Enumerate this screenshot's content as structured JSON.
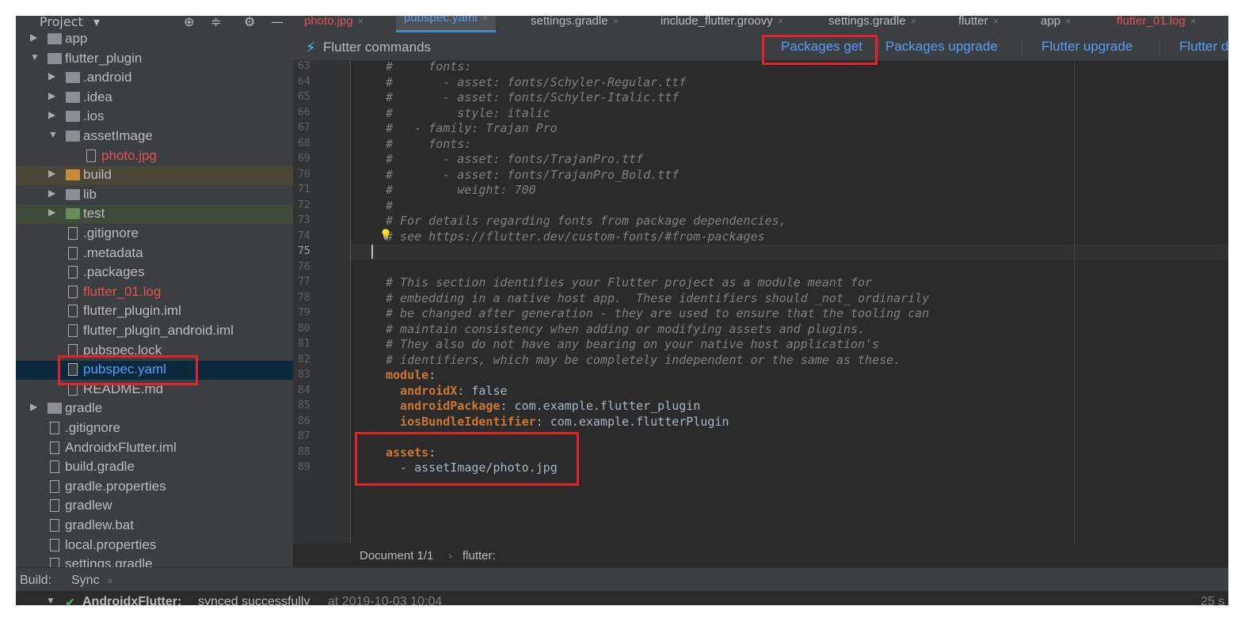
{
  "project_panel": {
    "title": "Project",
    "tree": [
      {
        "label": "app",
        "type": "module",
        "arrow": "▶"
      },
      {
        "label": "flutter_plugin",
        "type": "folder",
        "arrow": "▼"
      },
      {
        "label": ".android",
        "type": "folder",
        "arrow": "▶"
      },
      {
        "label": ".idea",
        "type": "folder",
        "arrow": "▶"
      },
      {
        "label": ".ios",
        "type": "folder",
        "arrow": "▶"
      },
      {
        "label": "assetImage",
        "type": "folder",
        "arrow": "▼"
      },
      {
        "label": "photo.jpg",
        "type": "file",
        "status": "red"
      },
      {
        "label": "build",
        "type": "folder-excluded",
        "arrow": "▶"
      },
      {
        "label": "lib",
        "type": "folder",
        "arrow": "▶"
      },
      {
        "label": "test",
        "type": "folder-test",
        "arrow": "▶"
      },
      {
        "label": ".gitignore",
        "type": "file"
      },
      {
        "label": ".metadata",
        "type": "file"
      },
      {
        "label": ".packages",
        "type": "file"
      },
      {
        "label": "flutter_01.log",
        "type": "file",
        "status": "red"
      },
      {
        "label": "flutter_plugin.iml",
        "type": "file"
      },
      {
        "label": "flutter_plugin_android.iml",
        "type": "file"
      },
      {
        "label": "pubspec.lock",
        "type": "file"
      },
      {
        "label": "pubspec.yaml",
        "type": "yaml",
        "selected": true
      },
      {
        "label": "README.md",
        "type": "file"
      },
      {
        "label": "gradle",
        "type": "folder",
        "arrow": "▶"
      },
      {
        "label": ".gitignore",
        "type": "file"
      },
      {
        "label": "AndroidxFlutter.iml",
        "type": "file"
      },
      {
        "label": "build.gradle",
        "type": "gradle"
      },
      {
        "label": "gradle.properties",
        "type": "file"
      },
      {
        "label": "gradlew",
        "type": "file"
      },
      {
        "label": "gradlew.bat",
        "type": "file"
      },
      {
        "label": "local.properties",
        "type": "file"
      },
      {
        "label": "settings.gradle",
        "type": "gradle"
      }
    ]
  },
  "tabs": [
    {
      "label": "photo.jpg",
      "status": "red"
    },
    {
      "label": "pubspec.yaml",
      "active": true
    },
    {
      "label": "settings.gradle"
    },
    {
      "label": "include_flutter.groovy"
    },
    {
      "label": "settings.gradle"
    },
    {
      "label": "flutter"
    },
    {
      "label": "app"
    },
    {
      "label": "flutter_01.log",
      "status": "red"
    }
  ],
  "flutter_bar": {
    "title": "Flutter commands",
    "commands": [
      "Packages get",
      "Packages upgrade",
      "Flutter upgrade",
      "Flutter d"
    ]
  },
  "editor": {
    "current_line": 75,
    "lines": [
      {
        "n": "63",
        "segs": [
          {
            "t": "#     fonts:",
            "c": "cmt"
          }
        ]
      },
      {
        "n": "64",
        "segs": [
          {
            "t": "#       - asset: fonts/Schyler-Regular.ttf",
            "c": "cmt"
          }
        ]
      },
      {
        "n": "65",
        "segs": [
          {
            "t": "#       - asset: fonts/Schyler-Italic.ttf",
            "c": "cmt"
          }
        ]
      },
      {
        "n": "66",
        "segs": [
          {
            "t": "#         style: italic",
            "c": "cmt"
          }
        ]
      },
      {
        "n": "67",
        "segs": [
          {
            "t": "#   - family: Trajan Pro",
            "c": "cmt"
          }
        ]
      },
      {
        "n": "68",
        "segs": [
          {
            "t": "#     fonts:",
            "c": "cmt"
          }
        ]
      },
      {
        "n": "69",
        "segs": [
          {
            "t": "#       - asset: fonts/TrajanPro.ttf",
            "c": "cmt"
          }
        ]
      },
      {
        "n": "70",
        "segs": [
          {
            "t": "#       - asset: fonts/TrajanPro_Bold.ttf",
            "c": "cmt"
          }
        ]
      },
      {
        "n": "71",
        "segs": [
          {
            "t": "#         weight: 700",
            "c": "cmt"
          }
        ]
      },
      {
        "n": "72",
        "segs": [
          {
            "t": "#",
            "c": "cmt"
          }
        ]
      },
      {
        "n": "73",
        "segs": [
          {
            "t": "# For details regarding fonts from package dependencies,",
            "c": "cmt"
          }
        ]
      },
      {
        "n": "74",
        "segs": [
          {
            "t": "# see https://flutter.dev/custom-fonts/#from-packages",
            "c": "cmt"
          }
        ]
      },
      {
        "n": "75",
        "segs": []
      },
      {
        "n": "76",
        "segs": []
      },
      {
        "n": "77",
        "segs": [
          {
            "t": "# This section identifies your Flutter project as a module meant for",
            "c": "cmt"
          }
        ]
      },
      {
        "n": "78",
        "segs": [
          {
            "t": "# embedding in a native host app.  These identifiers should _not_ ordinarily",
            "c": "cmt"
          }
        ]
      },
      {
        "n": "79",
        "segs": [
          {
            "t": "# be changed after generation - they are used to ensure that the tooling can",
            "c": "cmt"
          }
        ]
      },
      {
        "n": "80",
        "segs": [
          {
            "t": "# maintain consistency when adding or modifying assets and plugins.",
            "c": "cmt"
          }
        ]
      },
      {
        "n": "81",
        "segs": [
          {
            "t": "# They also do not have any bearing on your native host application's",
            "c": "cmt"
          }
        ]
      },
      {
        "n": "82",
        "segs": [
          {
            "t": "# identifiers, which may be completely independent or the same as these.",
            "c": "cmt"
          }
        ]
      },
      {
        "n": "83",
        "segs": [
          {
            "t": "module",
            "c": "key"
          },
          {
            "t": ":",
            "c": "val"
          }
        ]
      },
      {
        "n": "84",
        "segs": [
          {
            "t": "  androidX",
            "c": "key"
          },
          {
            "t": ": false",
            "c": "val"
          }
        ]
      },
      {
        "n": "85",
        "segs": [
          {
            "t": "  androidPackage",
            "c": "key"
          },
          {
            "t": ": com.example.flutter_plugin",
            "c": "val"
          }
        ]
      },
      {
        "n": "86",
        "segs": [
          {
            "t": "  iosBundleIdentifier",
            "c": "key"
          },
          {
            "t": ": com.example.flutterPlugin",
            "c": "val"
          }
        ]
      },
      {
        "n": "87",
        "segs": []
      },
      {
        "n": "88",
        "segs": [
          {
            "t": "assets",
            "c": "key"
          },
          {
            "t": ":",
            "c": "val"
          }
        ]
      },
      {
        "n": "89",
        "segs": [
          {
            "t": "  - assetImage/photo.jpg",
            "c": "val"
          }
        ]
      }
    ]
  },
  "breadcrumb": {
    "doc": "Document 1/1",
    "sep": "›",
    "path": "flutter:"
  },
  "build_bar": {
    "label": "Build:",
    "tab": "Sync",
    "close": "×"
  },
  "build_output": {
    "project": "AndroidxFlutter:",
    "message": "synced successfully",
    "time": "at 2019-10-03 10:04",
    "duration": "25 s"
  },
  "colors": {
    "highlight": "#e0242a",
    "accent": "#589df6",
    "bg": "#2b2b2b"
  }
}
